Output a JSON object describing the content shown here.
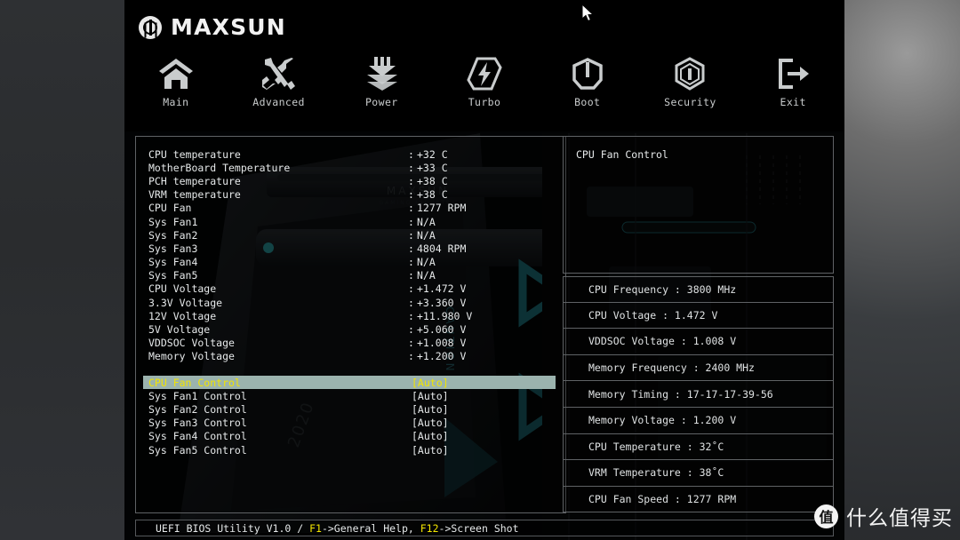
{
  "brand": {
    "name": "MAXSUN",
    "logo_icon": "maxsun-logo-icon"
  },
  "nav": {
    "items": [
      {
        "label": "Main",
        "icon": "home-icon"
      },
      {
        "label": "Advanced",
        "icon": "tools-icon"
      },
      {
        "label": "Power",
        "icon": "power-stack-icon"
      },
      {
        "label": "Turbo",
        "icon": "lightning-bolt-icon"
      },
      {
        "label": "Boot",
        "icon": "power-button-icon"
      },
      {
        "label": "Security",
        "icon": "shield-lock-icon"
      },
      {
        "label": "Exit",
        "icon": "exit-arrow-icon"
      }
    ]
  },
  "monitor": {
    "rows": [
      {
        "key": "CPU temperature",
        "sep": ":",
        "value": "+32 C"
      },
      {
        "key": "MotherBoard Temperature",
        "sep": ":",
        "value": "+33 C"
      },
      {
        "key": "PCH temperature",
        "sep": ":",
        "value": "+38 C"
      },
      {
        "key": "VRM temperature",
        "sep": ":",
        "value": "+38 C"
      },
      {
        "key": "CPU Fan",
        "sep": ":",
        "value": "1277 RPM"
      },
      {
        "key": "Sys Fan1",
        "sep": ":",
        "value": "N/A"
      },
      {
        "key": "Sys Fan2",
        "sep": ":",
        "value": "N/A"
      },
      {
        "key": "Sys Fan3",
        "sep": ":",
        "value": "4804 RPM"
      },
      {
        "key": "Sys Fan4",
        "sep": ":",
        "value": "N/A"
      },
      {
        "key": "Sys Fan5",
        "sep": ":",
        "value": "N/A"
      },
      {
        "key": "CPU Voltage",
        "sep": ":",
        "value": "+1.472 V"
      },
      {
        "key": "3.3V Voltage",
        "sep": ":",
        "value": "+3.360 V"
      },
      {
        "key": "12V Voltage",
        "sep": ":",
        "value": "+11.980 V"
      },
      {
        "key": "5V Voltage",
        "sep": ":",
        "value": "+5.060 V"
      },
      {
        "key": "VDDSOC Voltage",
        "sep": ":",
        "value": "+1.008 V"
      },
      {
        "key": "Memory Voltage",
        "sep": ":",
        "value": "+1.200 V"
      }
    ]
  },
  "controls": {
    "selected_index": 0,
    "rows": [
      {
        "key": "CPU Fan Control",
        "value": "[Auto]",
        "selected": true
      },
      {
        "key": "Sys Fan1 Control",
        "value": "[Auto]",
        "selected": false
      },
      {
        "key": "Sys Fan2 Control",
        "value": "[Auto]",
        "selected": false
      },
      {
        "key": "Sys Fan3 Control",
        "value": "[Auto]",
        "selected": false
      },
      {
        "key": "Sys Fan4 Control",
        "value": "[Auto]",
        "selected": false
      },
      {
        "key": "Sys Fan5 Control",
        "value": "[Auto]",
        "selected": false
      }
    ]
  },
  "help_panel": {
    "title": "CPU Fan Control",
    "body": ""
  },
  "system_info": {
    "rows": [
      "CPU Frequency : 3800 MHz",
      "CPU Voltage : 1.472 V",
      "VDDSOC Voltage : 1.008 V",
      "Memory Frequency : 2400 MHz",
      "Memory Timing : 17-17-17-39-56",
      "Memory Voltage : 1.200 V",
      "CPU Temperature : 32˚C",
      "VRM Temperature : 38˚C",
      "CPU Fan Speed : 1277 RPM"
    ]
  },
  "footer": {
    "prefix": "UEFI BIOS Utility V1.0 / ",
    "hotkey1": "F1",
    "mid1": "->General Help, ",
    "hotkey2": "F12",
    "mid2": "->Screen Shot"
  },
  "watermark": {
    "badge": "值",
    "text": "什么值得买"
  },
  "colors": {
    "selection_bg": "#9bb3ae",
    "selection_fg": "#f2e500",
    "hotkey": "#f2e500",
    "text": "#e6e9ea",
    "border": "#5f6265",
    "accent_teal": "#2b8a93"
  }
}
